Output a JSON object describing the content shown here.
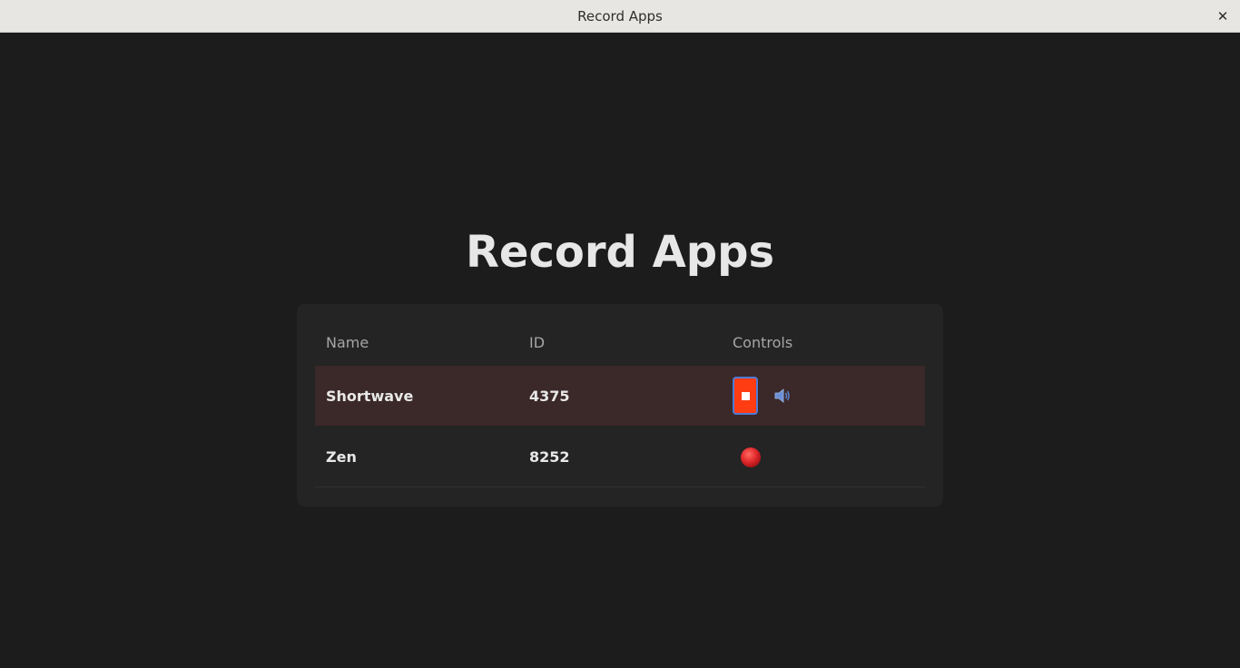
{
  "window": {
    "title": "Record Apps",
    "close_glyph": "✕"
  },
  "page": {
    "title": "Record Apps"
  },
  "table": {
    "columns": [
      "Name",
      "ID",
      "Controls"
    ],
    "rows": [
      {
        "name": "Shortwave",
        "id": "4375",
        "state": "recording",
        "controls": [
          "stop-icon",
          "speaker-icon"
        ]
      },
      {
        "name": "Zen",
        "id": "8252",
        "state": "idle",
        "controls": [
          "record-icon"
        ]
      }
    ]
  },
  "colors": {
    "background": "#1c1c1c",
    "card": "#242424",
    "active_row": "#3b2829",
    "stop_button": "#ff3c12",
    "focus_ring": "#4e7ad6",
    "record_dot": "#e0282b"
  }
}
